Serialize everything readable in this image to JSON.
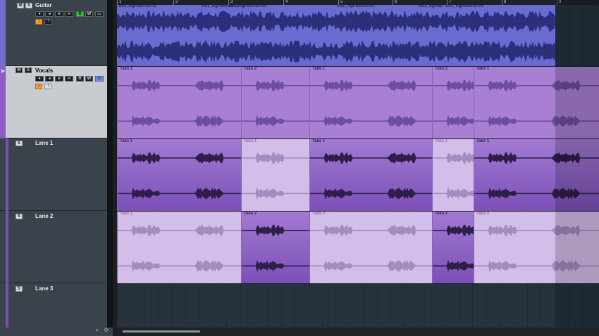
{
  "ruler": {
    "bars": [
      "1",
      "2",
      "3",
      "4",
      "5",
      "6",
      "7",
      "8",
      "9"
    ]
  },
  "tracks": {
    "guitar": {
      "name": "Guitar",
      "color": "#6f6ed0",
      "regions": [
        {
          "label": "SS1_AgPattAGt-01"
        },
        {
          "label": "SS1_AgPattAGt-02"
        },
        {
          "label": "SS1_AgPattAGt-04"
        },
        {
          "label": "SS1_AgPattAGt-01"
        },
        {
          "label": "SS1_AgPatt"
        },
        {
          "label": "SS1_AgPattAGt-04"
        }
      ]
    },
    "vocals": {
      "name": "Vocals",
      "color": "#8d5cc4",
      "takes": [
        "Take 1",
        "Take 2",
        "Take 1",
        "Take 2",
        "Take 1"
      ]
    },
    "lanes": [
      {
        "name": "Lane 1",
        "takes": [
          "Take 1",
          "Take 1",
          "Take 1",
          "Take 1",
          "Take 1"
        ],
        "active": [
          true,
          false,
          true,
          false,
          true
        ]
      },
      {
        "name": "Lane 2",
        "takes": [
          "Take 2",
          "Take 2",
          "Take 2",
          "Take 2",
          "Take 2"
        ],
        "active": [
          false,
          true,
          false,
          true,
          false
        ]
      },
      {
        "name": "Lane 3"
      }
    ]
  },
  "buttons": {
    "solo": "S",
    "mute": "M",
    "read": "R",
    "write": "W",
    "record": "●",
    "monitor": "◂",
    "edit": "e"
  }
}
